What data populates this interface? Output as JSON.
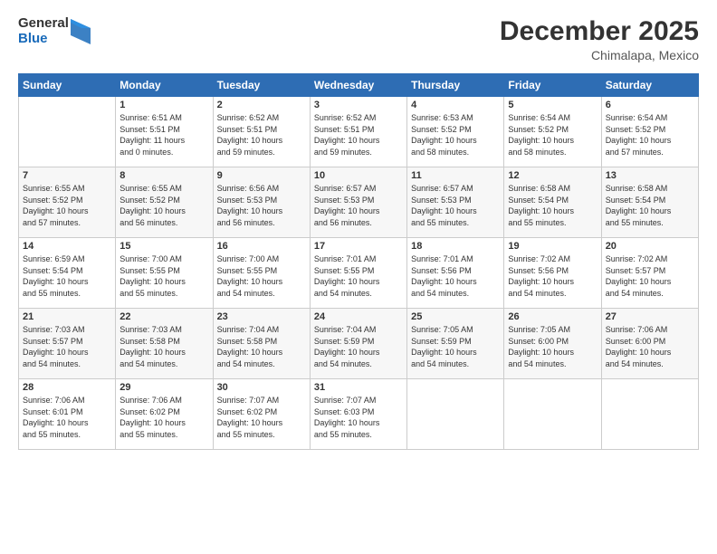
{
  "header": {
    "logo_line1": "General",
    "logo_line2": "Blue",
    "month": "December 2025",
    "location": "Chimalapa, Mexico"
  },
  "days_header": [
    "Sunday",
    "Monday",
    "Tuesday",
    "Wednesday",
    "Thursday",
    "Friday",
    "Saturday"
  ],
  "weeks": [
    [
      {
        "day": "",
        "info": ""
      },
      {
        "day": "1",
        "info": "Sunrise: 6:51 AM\nSunset: 5:51 PM\nDaylight: 11 hours\nand 0 minutes."
      },
      {
        "day": "2",
        "info": "Sunrise: 6:52 AM\nSunset: 5:51 PM\nDaylight: 10 hours\nand 59 minutes."
      },
      {
        "day": "3",
        "info": "Sunrise: 6:52 AM\nSunset: 5:51 PM\nDaylight: 10 hours\nand 59 minutes."
      },
      {
        "day": "4",
        "info": "Sunrise: 6:53 AM\nSunset: 5:52 PM\nDaylight: 10 hours\nand 58 minutes."
      },
      {
        "day": "5",
        "info": "Sunrise: 6:54 AM\nSunset: 5:52 PM\nDaylight: 10 hours\nand 58 minutes."
      },
      {
        "day": "6",
        "info": "Sunrise: 6:54 AM\nSunset: 5:52 PM\nDaylight: 10 hours\nand 57 minutes."
      }
    ],
    [
      {
        "day": "7",
        "info": "Sunrise: 6:55 AM\nSunset: 5:52 PM\nDaylight: 10 hours\nand 57 minutes."
      },
      {
        "day": "8",
        "info": "Sunrise: 6:55 AM\nSunset: 5:52 PM\nDaylight: 10 hours\nand 56 minutes."
      },
      {
        "day": "9",
        "info": "Sunrise: 6:56 AM\nSunset: 5:53 PM\nDaylight: 10 hours\nand 56 minutes."
      },
      {
        "day": "10",
        "info": "Sunrise: 6:57 AM\nSunset: 5:53 PM\nDaylight: 10 hours\nand 56 minutes."
      },
      {
        "day": "11",
        "info": "Sunrise: 6:57 AM\nSunset: 5:53 PM\nDaylight: 10 hours\nand 55 minutes."
      },
      {
        "day": "12",
        "info": "Sunrise: 6:58 AM\nSunset: 5:54 PM\nDaylight: 10 hours\nand 55 minutes."
      },
      {
        "day": "13",
        "info": "Sunrise: 6:58 AM\nSunset: 5:54 PM\nDaylight: 10 hours\nand 55 minutes."
      }
    ],
    [
      {
        "day": "14",
        "info": "Sunrise: 6:59 AM\nSunset: 5:54 PM\nDaylight: 10 hours\nand 55 minutes."
      },
      {
        "day": "15",
        "info": "Sunrise: 7:00 AM\nSunset: 5:55 PM\nDaylight: 10 hours\nand 55 minutes."
      },
      {
        "day": "16",
        "info": "Sunrise: 7:00 AM\nSunset: 5:55 PM\nDaylight: 10 hours\nand 54 minutes."
      },
      {
        "day": "17",
        "info": "Sunrise: 7:01 AM\nSunset: 5:55 PM\nDaylight: 10 hours\nand 54 minutes."
      },
      {
        "day": "18",
        "info": "Sunrise: 7:01 AM\nSunset: 5:56 PM\nDaylight: 10 hours\nand 54 minutes."
      },
      {
        "day": "19",
        "info": "Sunrise: 7:02 AM\nSunset: 5:56 PM\nDaylight: 10 hours\nand 54 minutes."
      },
      {
        "day": "20",
        "info": "Sunrise: 7:02 AM\nSunset: 5:57 PM\nDaylight: 10 hours\nand 54 minutes."
      }
    ],
    [
      {
        "day": "21",
        "info": "Sunrise: 7:03 AM\nSunset: 5:57 PM\nDaylight: 10 hours\nand 54 minutes."
      },
      {
        "day": "22",
        "info": "Sunrise: 7:03 AM\nSunset: 5:58 PM\nDaylight: 10 hours\nand 54 minutes."
      },
      {
        "day": "23",
        "info": "Sunrise: 7:04 AM\nSunset: 5:58 PM\nDaylight: 10 hours\nand 54 minutes."
      },
      {
        "day": "24",
        "info": "Sunrise: 7:04 AM\nSunset: 5:59 PM\nDaylight: 10 hours\nand 54 minutes."
      },
      {
        "day": "25",
        "info": "Sunrise: 7:05 AM\nSunset: 5:59 PM\nDaylight: 10 hours\nand 54 minutes."
      },
      {
        "day": "26",
        "info": "Sunrise: 7:05 AM\nSunset: 6:00 PM\nDaylight: 10 hours\nand 54 minutes."
      },
      {
        "day": "27",
        "info": "Sunrise: 7:06 AM\nSunset: 6:00 PM\nDaylight: 10 hours\nand 54 minutes."
      }
    ],
    [
      {
        "day": "28",
        "info": "Sunrise: 7:06 AM\nSunset: 6:01 PM\nDaylight: 10 hours\nand 55 minutes."
      },
      {
        "day": "29",
        "info": "Sunrise: 7:06 AM\nSunset: 6:02 PM\nDaylight: 10 hours\nand 55 minutes."
      },
      {
        "day": "30",
        "info": "Sunrise: 7:07 AM\nSunset: 6:02 PM\nDaylight: 10 hours\nand 55 minutes."
      },
      {
        "day": "31",
        "info": "Sunrise: 7:07 AM\nSunset: 6:03 PM\nDaylight: 10 hours\nand 55 minutes."
      },
      {
        "day": "",
        "info": ""
      },
      {
        "day": "",
        "info": ""
      },
      {
        "day": "",
        "info": ""
      }
    ]
  ]
}
